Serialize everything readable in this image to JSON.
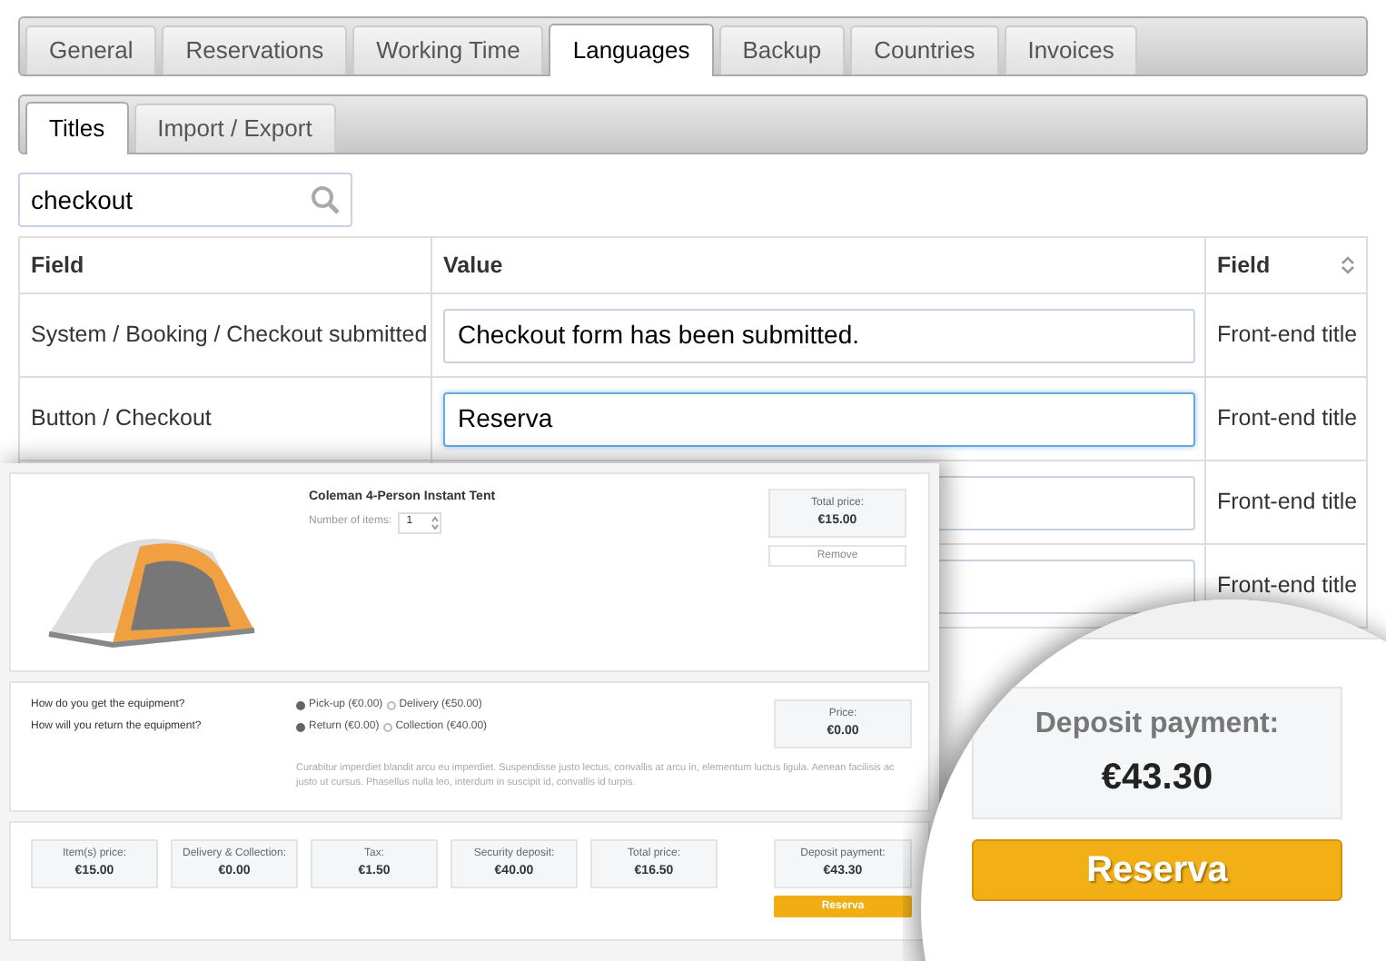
{
  "tabs": [
    {
      "label": "General",
      "selected": false
    },
    {
      "label": "Reservations",
      "selected": false
    },
    {
      "label": "Working Time",
      "selected": false
    },
    {
      "label": "Languages",
      "selected": true
    },
    {
      "label": "Backup",
      "selected": false
    },
    {
      "label": "Countries",
      "selected": false
    },
    {
      "label": "Invoices",
      "selected": false
    }
  ],
  "subtabs": [
    {
      "label": "Titles",
      "selected": true
    },
    {
      "label": "Import / Export",
      "selected": false
    }
  ],
  "search": {
    "value": "checkout"
  },
  "table": {
    "columns": [
      "Field",
      "Value",
      "Field"
    ],
    "rows": [
      {
        "field": "System / Booking / Checkout submitted",
        "value": "Checkout form has been submitted.",
        "column_3": "Front-end title",
        "focused": false
      },
      {
        "field": "Button / Checkout",
        "value": "Reserva",
        "column_3": "Front-end title",
        "focused": true
      },
      {
        "column_3": "Front-end title",
        "focused": false
      },
      {
        "column_3": "Front-end title",
        "focused": false
      }
    ]
  },
  "preview": {
    "product": {
      "name": "Coleman 4-Person Instant Tent",
      "quantity_label": "Number of items:",
      "quantity": "1",
      "total_label": "Total price:",
      "total": "€15.00",
      "remove": "Remove"
    },
    "options": {
      "questions": [
        {
          "label": "How do you get the equipment?",
          "choices": [
            {
              "label": "Pick-up (€0.00)",
              "selected": true
            },
            {
              "label": "Delivery (€50.00)",
              "selected": false
            }
          ]
        },
        {
          "label": "How will you return the equipment?",
          "choices": [
            {
              "label": "Return (€0.00)",
              "selected": true
            },
            {
              "label": "Collection (€40.00)",
              "selected": false
            }
          ]
        }
      ],
      "price_label": "Price:",
      "price": "€0.00",
      "note": "Curabitur imperdiet blandit arcu eu imperdiet. Suspendisse justo lectus, convallis at arcu in, elementum luctus ligula. Aenean facilisis ac justo ut cursus. Phasellus nulla leo, interdum in suscipit id, convallis id turpis."
    },
    "summary": [
      {
        "label": "Item(s) price:",
        "value": "€15.00"
      },
      {
        "label": "Delivery & Collection:",
        "value": "€0.00"
      },
      {
        "label": "Tax:",
        "value": "€1.50"
      },
      {
        "label": "Security deposit:",
        "value": "€40.00"
      },
      {
        "label": "Total price:",
        "value": "€16.50"
      }
    ],
    "deposit": {
      "label": "Deposit payment:",
      "value": "€43.30",
      "button": "Reserva"
    }
  },
  "magnifier": {
    "label": "Deposit payment:",
    "value": "€43.30",
    "button": "Reserva"
  }
}
